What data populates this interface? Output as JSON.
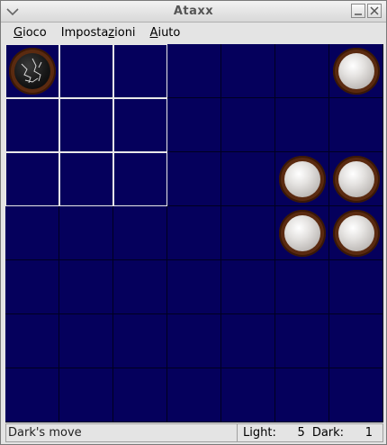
{
  "window": {
    "title": "Ataxx"
  },
  "menu": {
    "items": [
      {
        "label": "Gioco",
        "mnemonic": "G"
      },
      {
        "label": "Impostazioni",
        "mnemonic": "z"
      },
      {
        "label": "Aiuto",
        "mnemonic": "A"
      }
    ]
  },
  "board": {
    "size": 7,
    "cell_color": "#05005c",
    "selection_color": "#e8e8e8",
    "selected": {
      "row": 0,
      "col": 0
    },
    "highlighted_cells": [
      [
        0,
        0
      ],
      [
        0,
        1
      ],
      [
        0,
        2
      ],
      [
        1,
        0
      ],
      [
        1,
        1
      ],
      [
        1,
        2
      ],
      [
        2,
        0
      ],
      [
        2,
        1
      ],
      [
        2,
        2
      ]
    ],
    "pieces": [
      {
        "row": 0,
        "col": 0,
        "color": "dark"
      },
      {
        "row": 0,
        "col": 6,
        "color": "light"
      },
      {
        "row": 2,
        "col": 5,
        "color": "light"
      },
      {
        "row": 2,
        "col": 6,
        "color": "light"
      },
      {
        "row": 3,
        "col": 5,
        "color": "light"
      },
      {
        "row": 3,
        "col": 6,
        "color": "light"
      }
    ]
  },
  "status": {
    "message": "Dark's move",
    "light_label": "Light:",
    "light_count": "5",
    "dark_label": "Dark:",
    "dark_count": "1"
  }
}
